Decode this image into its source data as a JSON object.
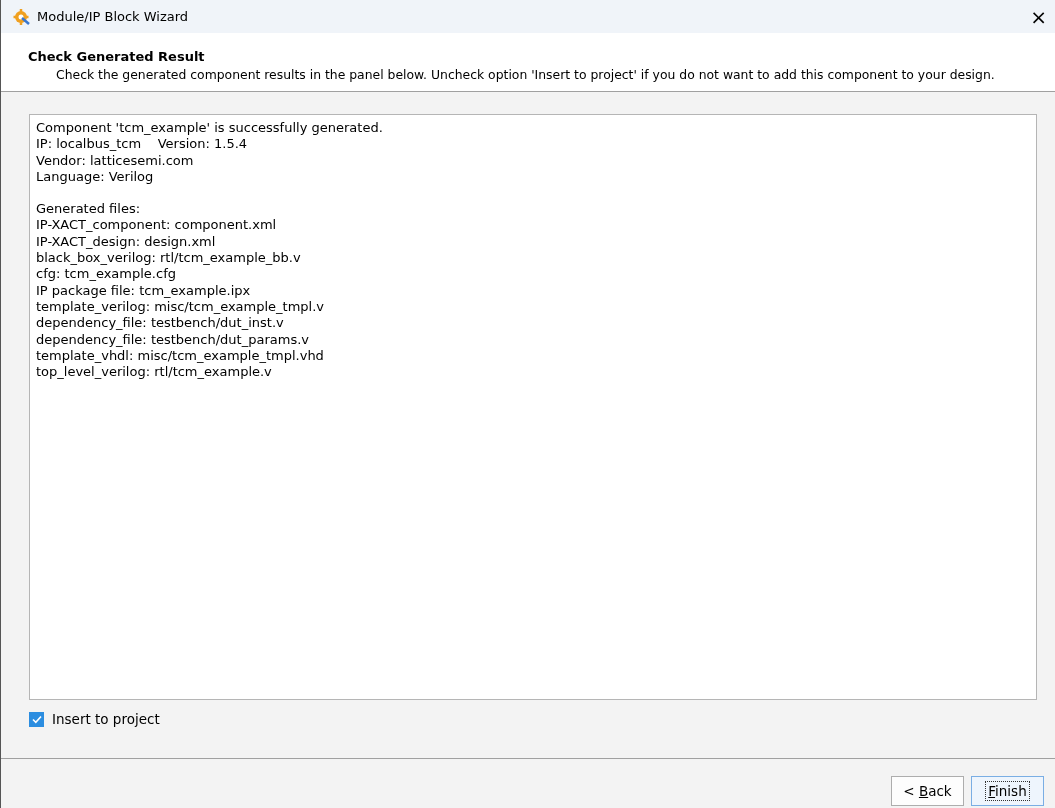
{
  "window": {
    "title": "Module/IP Block Wizard",
    "close": "×"
  },
  "header": {
    "title": "Check Generated Result",
    "description": "Check the generated component results in the panel below. Uncheck option 'Insert to project' if you do not want to add this component to your design."
  },
  "output": {
    "paragraphs": [
      [
        "Component 'tcm_example' is successfully generated.",
        "IP: localbus_tcm    Version: 1.5.4",
        "Vendor: latticesemi.com",
        "Language: Verilog"
      ],
      [
        "Generated files:",
        "IP-XACT_component: component.xml",
        "IP-XACT_design: design.xml",
        "black_box_verilog: rtl/tcm_example_bb.v",
        "cfg: tcm_example.cfg",
        "IP package file: tcm_example.ipx",
        "template_verilog: misc/tcm_example_tmpl.v",
        "dependency_file: testbench/dut_inst.v",
        "dependency_file: testbench/dut_params.v",
        "template_vhdl: misc/tcm_example_tmpl.vhd",
        "top_level_verilog: rtl/tcm_example.v"
      ]
    ]
  },
  "insert_to_project": {
    "label": "Insert to project",
    "checked": true
  },
  "buttons": [
    {
      "before": "< ",
      "mnemonic": "B",
      "after": "ack",
      "default": false
    },
    {
      "mnemonic": "F",
      "after": "inish",
      "default": true
    }
  ]
}
